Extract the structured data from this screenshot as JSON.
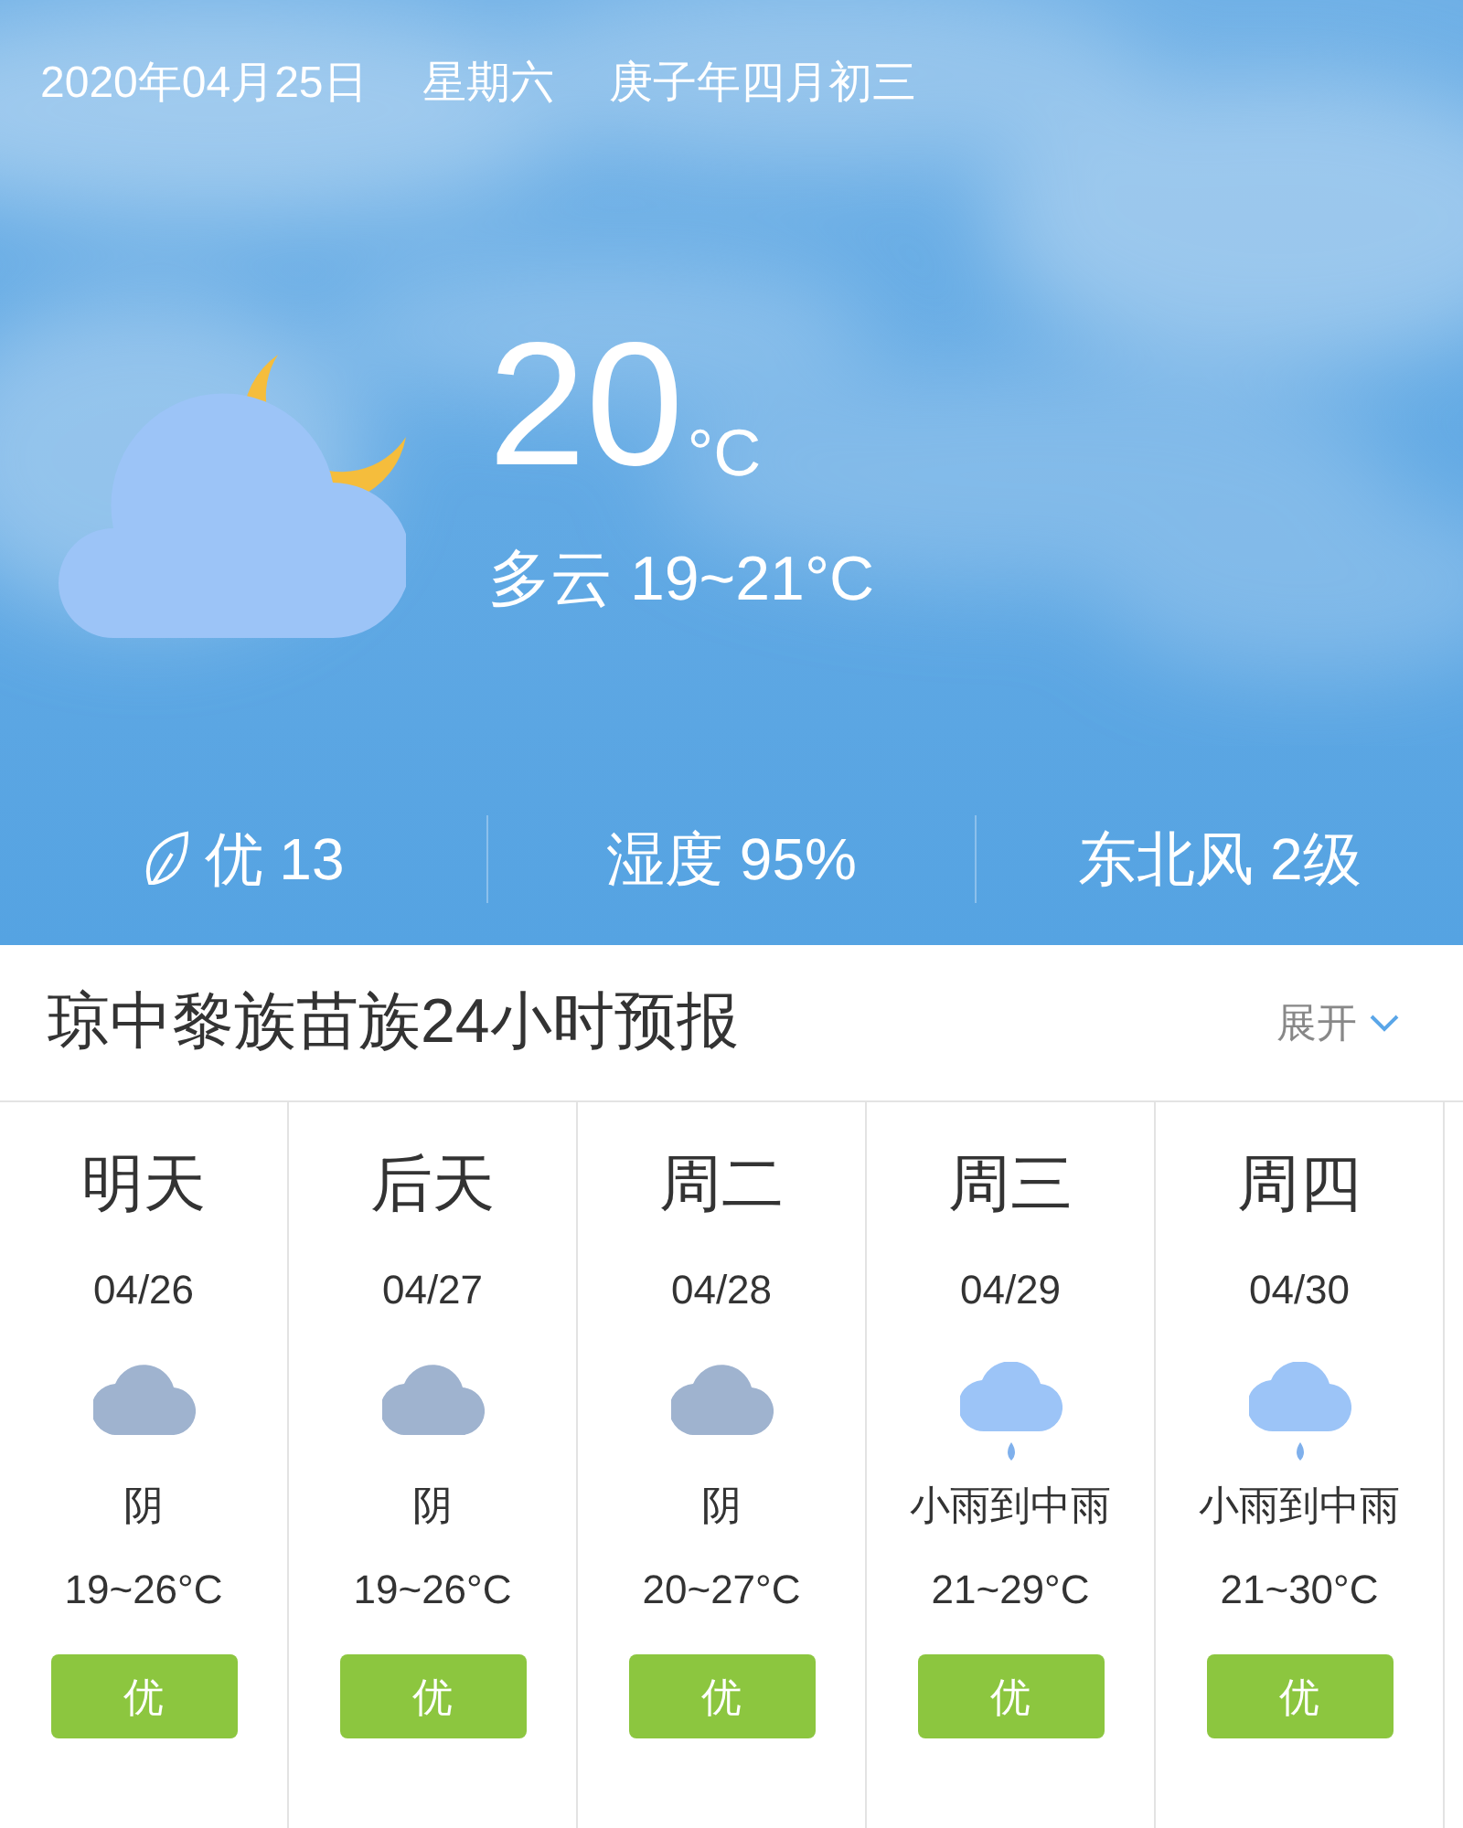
{
  "header": {
    "date": "2020年04月25日",
    "weekday": "星期六",
    "lunar": "庚子年四月初三",
    "temperature": "20",
    "unit": "°C",
    "condition": "多云 19~21°C"
  },
  "stats": [
    {
      "kind": "aqi",
      "text": "优 13"
    },
    {
      "kind": "plain",
      "text": "湿度 95%"
    },
    {
      "kind": "plain",
      "text": "东北风 2级"
    }
  ],
  "forecast": {
    "title": "琼中黎族苗族24小时预报",
    "expand": "展开"
  },
  "days": [
    {
      "name": "明天",
      "date": "04/26",
      "kind": "cloudy",
      "condition": "阴",
      "temps": "19~26°C",
      "aqi": "优",
      "color": "#8cc63f"
    },
    {
      "name": "后天",
      "date": "04/27",
      "kind": "cloudy",
      "condition": "阴",
      "temps": "19~26°C",
      "aqi": "优",
      "color": "#8cc63f"
    },
    {
      "name": "周二",
      "date": "04/28",
      "kind": "cloudy",
      "condition": "阴",
      "temps": "20~27°C",
      "aqi": "优",
      "color": "#8cc63f"
    },
    {
      "name": "周三",
      "date": "04/29",
      "kind": "rain",
      "condition": "小雨到中雨",
      "temps": "21~29°C",
      "aqi": "优",
      "color": "#8cc63f"
    },
    {
      "name": "周四",
      "date": "04/30",
      "kind": "rain",
      "condition": "小雨到中雨",
      "temps": "21~30°C",
      "aqi": "优",
      "color": "#8cc63f"
    }
  ]
}
